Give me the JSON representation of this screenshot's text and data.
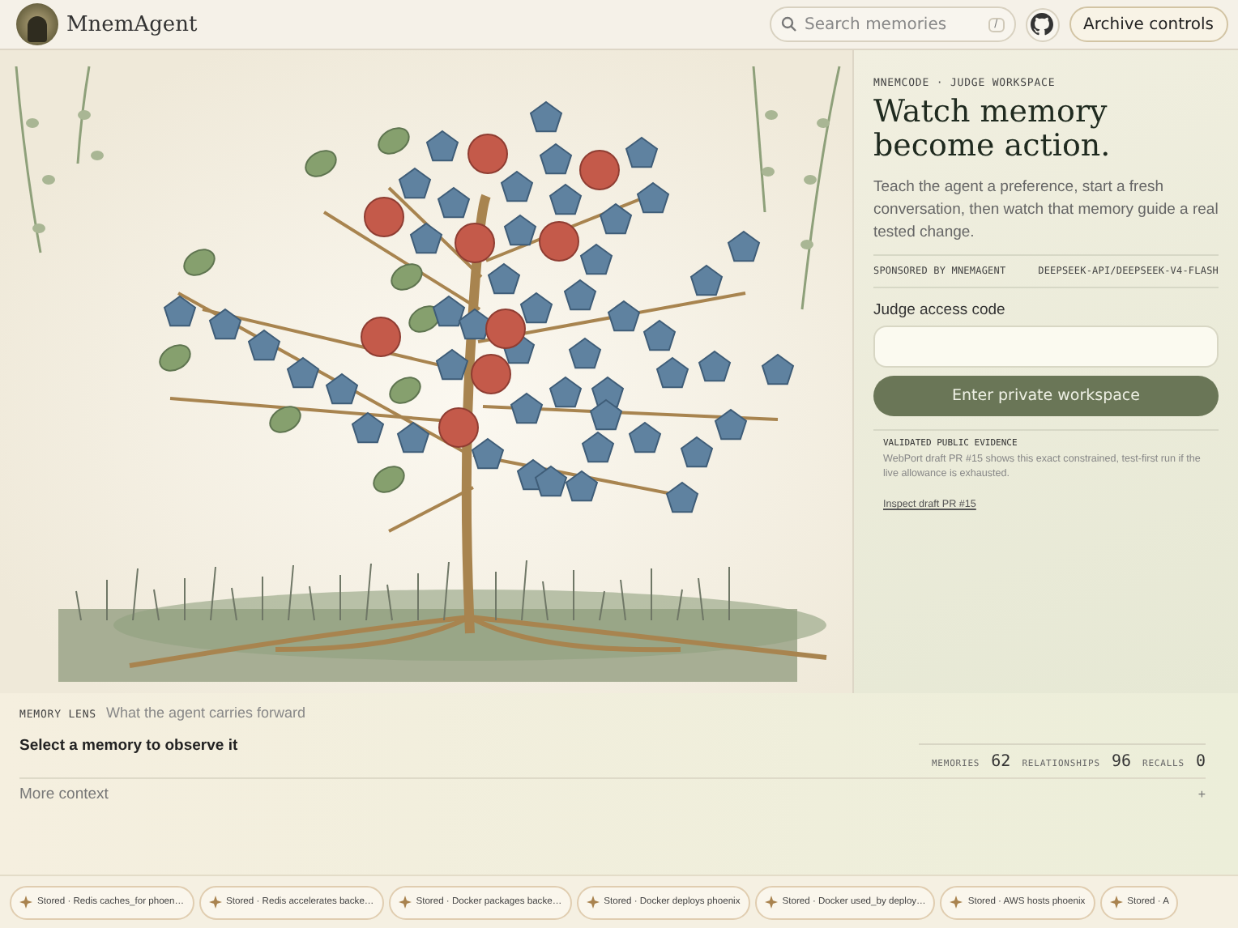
{
  "header": {
    "brand": "MnemAgent",
    "search": {
      "placeholder": "Search memories",
      "shortcut": "/"
    },
    "archive_button": "Archive controls"
  },
  "panel": {
    "eyebrow": "MNEMCODE · JUDGE WORKSPACE",
    "title_lines": [
      "Watch memory",
      "become action."
    ],
    "intro": "Teach the agent a preference, start a fresh conversation, then watch that memory guide a real tested change.",
    "sponsor": "SPONSORED BY MNEMAGENT",
    "model": "DEEPSEEK-API/DEEPSEEK-V4-FLASH",
    "field_label": "Judge access code",
    "submit": "Enter private workspace",
    "evidence": {
      "heading": "VALIDATED PUBLIC EVIDENCE",
      "text": "WebPort draft PR #15 shows this exact constrained, test-first run if the live allowance is exhausted.",
      "link": "Inspect draft PR #15"
    }
  },
  "lens": {
    "label": "MEMORY LENS",
    "subtitle": "What the agent carries forward",
    "prompt": "Select a memory to observe it",
    "stats": [
      {
        "label": "MEMORIES",
        "value": "62"
      },
      {
        "label": "RELATIONSHIPS",
        "value": "96"
      },
      {
        "label": "RECALLS",
        "value": "0"
      }
    ],
    "more": "More context",
    "expander": "+",
    "expanded": false
  },
  "ticker": [
    {
      "text": "Stored · Redis caches_for phoen…"
    },
    {
      "text": "Stored · Redis accelerates backe…"
    },
    {
      "text": "Stored · Docker packages backe…"
    },
    {
      "text": "Stored · Docker deploys phoenix"
    },
    {
      "text": "Stored · Docker used_by deploy…"
    },
    {
      "text": "Stored · AWS hosts phoenix"
    },
    {
      "text": "Stored · A"
    }
  ]
}
